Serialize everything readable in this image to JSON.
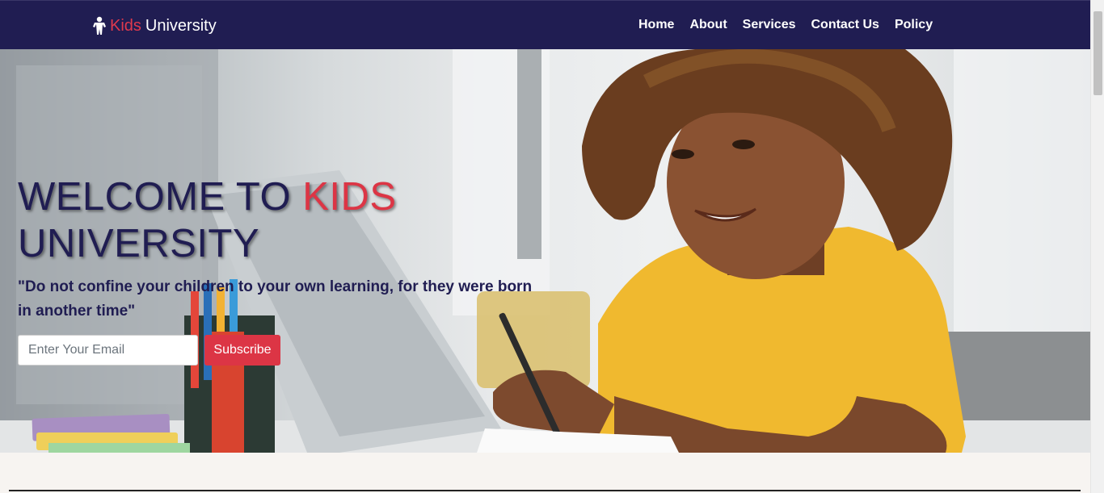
{
  "brand": {
    "icon": "child-icon",
    "kids": "Kids",
    "university": "University"
  },
  "nav": {
    "items": [
      {
        "label": "Home"
      },
      {
        "label": "About"
      },
      {
        "label": "Services"
      },
      {
        "label": "Contact Us"
      },
      {
        "label": "Policy"
      }
    ]
  },
  "hero": {
    "title_part1": "WELCOME TO ",
    "title_accent": "KIDS",
    "title_part2": "UNIVERSITY",
    "quote": "\"Do not confine your children to your own learning, for they were born in another time\"",
    "email_placeholder": "Enter Your Email",
    "subscribe_label": "Subscribe"
  },
  "colors": {
    "navbar": "#201d52",
    "accent": "#dc3545",
    "page_bg": "#f7f4f1"
  }
}
